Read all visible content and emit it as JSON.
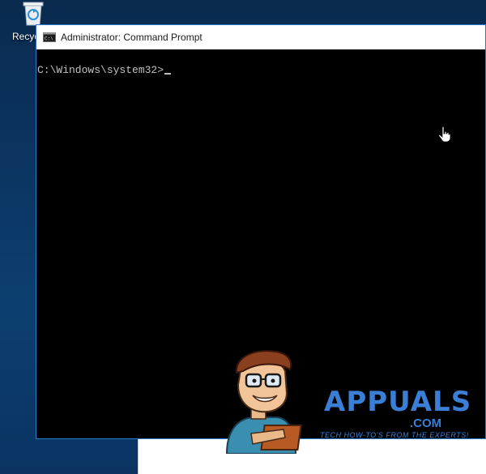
{
  "desktop": {
    "recycle_bin_label": "Recyc"
  },
  "window": {
    "title": "Administrator: Command Prompt",
    "icon": "cmd-icon"
  },
  "console": {
    "prompt": "C:\\Windows\\system32>"
  },
  "watermark": {
    "brand": "APPUALS",
    "domain": ".COM",
    "tagline": "TECH HOW-TO'S FROM THE EXPERTS!"
  },
  "colors": {
    "accent": "#2b78c9",
    "watermark": "#3a7fd5",
    "console_bg": "#000000",
    "console_text": "#c0c0c0"
  }
}
